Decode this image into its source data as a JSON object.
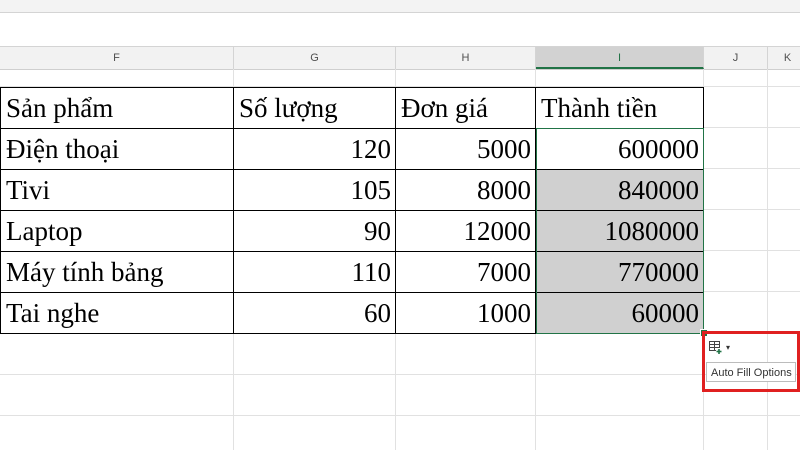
{
  "columns": [
    "F",
    "G",
    "H",
    "I",
    "J",
    "K"
  ],
  "selected_column": "I",
  "table": {
    "headers": [
      "Sản phẩm",
      "Số lượng",
      "Đơn giá",
      "Thành tiền"
    ],
    "rows": [
      [
        "Điện thoại",
        "120",
        "5000",
        "600000"
      ],
      [
        "Tivi",
        "105",
        "8000",
        "840000"
      ],
      [
        "Laptop",
        "90",
        "12000",
        "1080000"
      ],
      [
        "Máy tính bảng",
        "110",
        "7000",
        "770000"
      ],
      [
        "Tai nghe",
        "60",
        "1000",
        "60000"
      ]
    ]
  },
  "auto_fill": {
    "icon": "auto-fill-options-icon",
    "caret": "▾",
    "tooltip": "Auto Fill Options"
  },
  "colors": {
    "selection": "#217346",
    "filled_cells": "#d0d0d0",
    "highlight_box": "#e02020"
  }
}
